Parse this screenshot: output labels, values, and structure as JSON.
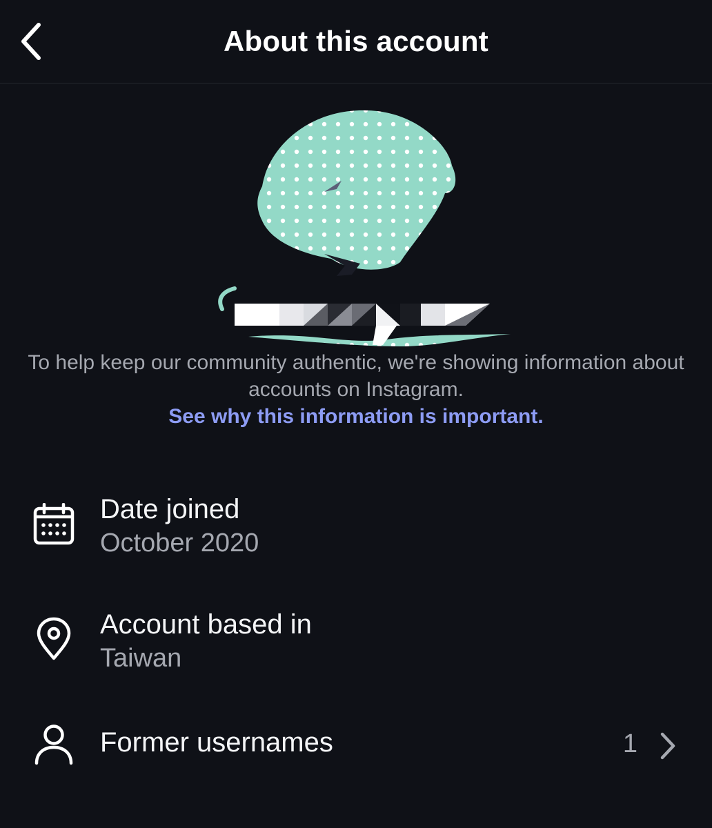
{
  "header": {
    "title": "About this account",
    "back_icon": "chevron-left-icon"
  },
  "profile": {
    "avatar": "profile-picture"
  },
  "notice": {
    "text": "To help keep our community authentic, we're showing information about accounts on Instagram.",
    "link": "See why this information is important."
  },
  "details": {
    "date_joined": {
      "icon": "calendar-icon",
      "label": "Date joined",
      "value": "October 2020"
    },
    "based_in": {
      "icon": "location-pin-icon",
      "label": "Account based in",
      "value": "Taiwan"
    },
    "former_usernames": {
      "icon": "person-icon",
      "label": "Former usernames",
      "count": "1",
      "chevron_icon": "chevron-right-icon"
    }
  },
  "colors": {
    "background": "#0f1117",
    "link": "#8d9cf4",
    "avatar_fill": "#93d9c7",
    "secondary_text": "#a5a8b0"
  }
}
